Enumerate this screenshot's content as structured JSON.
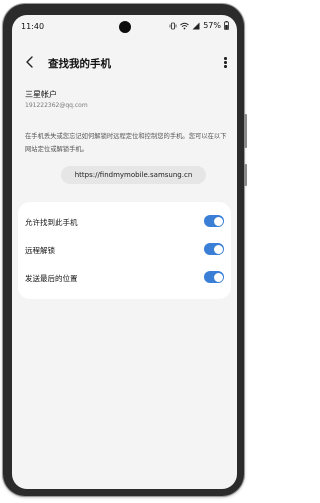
{
  "status_bar": {
    "time": "11:40",
    "battery": "57%"
  },
  "header": {
    "title": "查找我的手机"
  },
  "account": {
    "name": "三星帐户",
    "email": "191222362@qq.com"
  },
  "description": {
    "text": "在手机丢失或您忘记如何解锁时远程定位和控制您的手机。您可以在以下网站定位或解锁手机。"
  },
  "website": {
    "url": "https://findmymobile.samsung.cn"
  },
  "settings": {
    "items": [
      {
        "label": "允许找到此手机",
        "enabled": true
      },
      {
        "label": "远程解锁",
        "enabled": true
      },
      {
        "label": "发送最后的位置",
        "enabled": true
      }
    ]
  },
  "colors": {
    "toggle_on": "#3a7fd5",
    "screen_bg": "#f4f4f4"
  }
}
